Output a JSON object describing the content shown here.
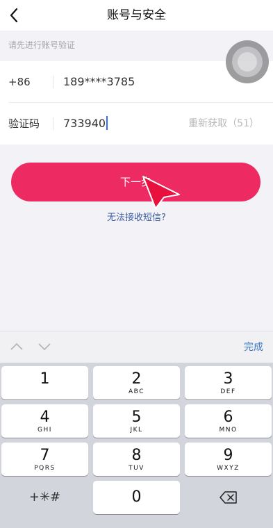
{
  "header": {
    "title": "账号与安全",
    "back_icon": "chevron-left-icon"
  },
  "hint": "请先进行账号验证",
  "form": {
    "phone": {
      "prefix": "+86",
      "value": "189****3785"
    },
    "code": {
      "label": "验证码",
      "value": "733940",
      "resend": "重新获取（51）"
    }
  },
  "next_button": "下一步",
  "cant_receive": "无法接收短信?",
  "keyboard": {
    "toolbar": {
      "done": "完成",
      "prev_icon": "chevron-up-icon",
      "next_icon": "chevron-down-icon"
    },
    "keys": [
      {
        "num": "1",
        "letters": ""
      },
      {
        "num": "2",
        "letters": "ABC"
      },
      {
        "num": "3",
        "letters": "DEF"
      },
      {
        "num": "4",
        "letters": "GHI"
      },
      {
        "num": "5",
        "letters": "JKL"
      },
      {
        "num": "6",
        "letters": "MNO"
      },
      {
        "num": "7",
        "letters": "PQRS"
      },
      {
        "num": "8",
        "letters": "TUV"
      },
      {
        "num": "9",
        "letters": "WXYZ"
      }
    ],
    "symbols": "+✳#",
    "zero": "0",
    "delete_icon": "backspace-icon"
  },
  "colors": {
    "accent": "#ee2a62",
    "link": "#3b5fa0",
    "done": "#3a79c9"
  }
}
